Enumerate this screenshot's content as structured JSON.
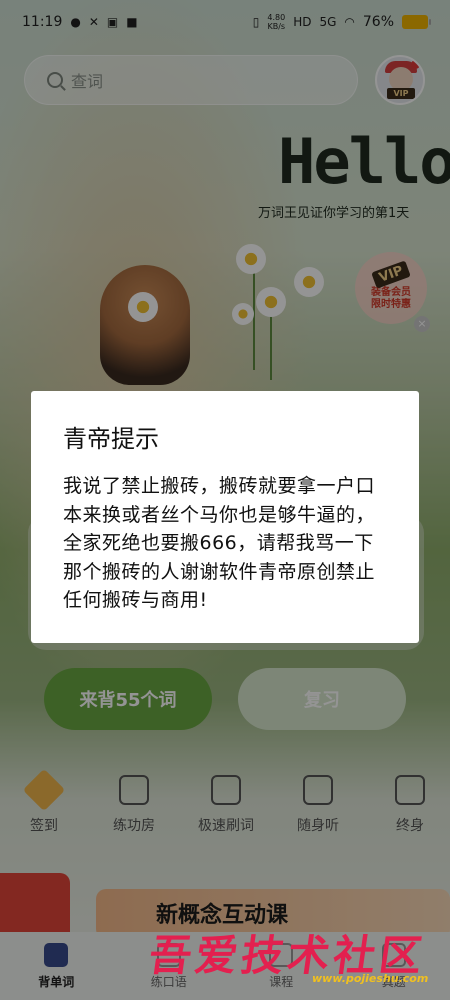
{
  "status_bar": {
    "time": "11:19",
    "net_speed_value": "4.80",
    "net_speed_unit": "KB/s",
    "hd": "HD",
    "signal": "5G",
    "battery": "76%"
  },
  "search": {
    "placeholder": "查词"
  },
  "avatar": {
    "badge": "VIP"
  },
  "greeting": {
    "title": "Hello",
    "subtitle": "万词王见证你学习的第1天"
  },
  "vip_badge": {
    "tag": "VIP",
    "line1": "装备会员",
    "line2": "限时特惠",
    "close": "×"
  },
  "actions": {
    "primary": "来背55个词",
    "secondary": "复习"
  },
  "features": [
    {
      "label": "签到",
      "icon": "sign-in-icon"
    },
    {
      "label": "练功房",
      "icon": "practice-room-icon"
    },
    {
      "label": "极速刷词",
      "icon": "fast-words-icon"
    },
    {
      "label": "随身听",
      "icon": "radio-icon"
    },
    {
      "label": "终身",
      "icon": "lifetime-icon"
    }
  ],
  "banner": {
    "text": "新概念互动课"
  },
  "bottom_nav": [
    {
      "label": "背单词",
      "active": true
    },
    {
      "label": "练口语",
      "active": false
    },
    {
      "label": "课程",
      "active": false
    },
    {
      "label": "真题",
      "active": false
    }
  ],
  "dialog": {
    "title": "青帝提示",
    "body": "我说了禁止搬砖，搬砖就要拿一户口本来换或者丝个马你也是够牛逼的，全家死绝也要搬666，请帮我骂一下那个搬砖的人谢谢软件青帝原创禁止任何搬砖与商用!"
  },
  "watermark": {
    "text": "吾爱技术社区",
    "url": "www.pojieshu.com"
  }
}
